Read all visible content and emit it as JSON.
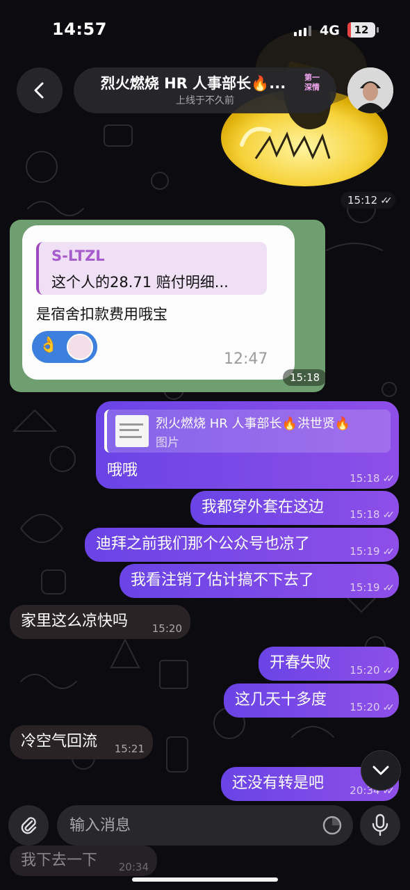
{
  "status_bar": {
    "time": "14:57",
    "network": "4G",
    "battery": "12",
    "battery_level": 0.12
  },
  "header": {
    "title": "烈火燃烧 HR 人事部长🔥...",
    "badge": "第一深情",
    "status": "上线于不久前"
  },
  "sticker": {
    "time": "15:12"
  },
  "photo": {
    "reply_name": "S-LTZL",
    "reply_text": "这个人的28.71 赔付明细...",
    "message": "是宿舍扣款费用哦宝",
    "reaction_emoji": "👌",
    "inner_time": "12:47",
    "time": "15:18"
  },
  "messages": [
    {
      "id": "m1",
      "dir": "out",
      "text": "哦哦",
      "time": "15:18",
      "reply": {
        "name": "烈火燃烧 HR 人事部长🔥洪世贤🔥",
        "sub": "图片"
      }
    },
    {
      "id": "m2",
      "dir": "out",
      "text": "我都穿外套在这边",
      "time": "15:18"
    },
    {
      "id": "m3",
      "dir": "out",
      "text": "迪拜之前我们那个公众号也凉了",
      "time": "15:19"
    },
    {
      "id": "m4",
      "dir": "out",
      "text": "我看注销了估计搞不下去了",
      "time": "15:19"
    },
    {
      "id": "m5",
      "dir": "in",
      "text": "家里这么凉快吗",
      "time": "15:20"
    },
    {
      "id": "m6",
      "dir": "out",
      "text": "开春失败",
      "time": "15:20"
    },
    {
      "id": "m7",
      "dir": "out",
      "text": "这几天十多度",
      "time": "15:20"
    },
    {
      "id": "m8",
      "dir": "in",
      "text": "冷空气回流",
      "time": "15:21"
    },
    {
      "id": "m9",
      "dir": "out",
      "text": "还没有转是吧",
      "time": "20:34"
    }
  ],
  "faded_messages": [
    {
      "text": "我下去一下",
      "time": "20:34"
    }
  ],
  "composer": {
    "placeholder": "输入消息"
  },
  "colors": {
    "outgoing": "#7b4aea",
    "incoming": "#2a2325",
    "background": "#0c0b0f"
  }
}
